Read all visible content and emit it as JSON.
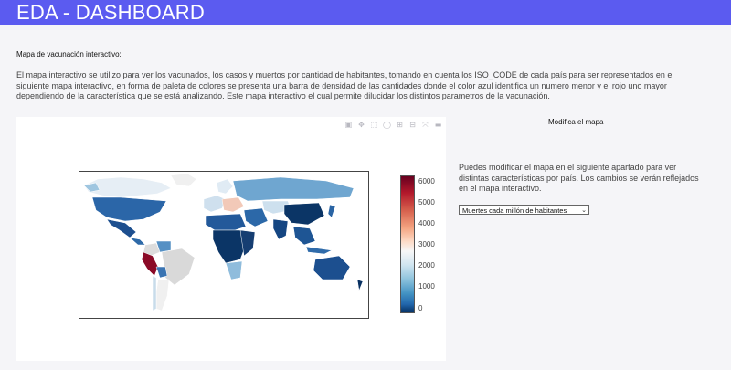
{
  "header": {
    "title": "EDA - DASHBOARD"
  },
  "main": {
    "section_title": "Mapa de vacunación interactivo:",
    "description": "El mapa interactivo se utilizo para ver los vacunados, los casos y muertos por cantidad de habitantes, tomando en cuenta los ISO_CODE de cada país para ser representados en el siguiente mapa interactivo, en forma de paleta de colores se presenta una barra de densidad de las cantidades donde el color azul identifica un numero menor y el rojo uno mayor dependiendo de la característica que se está analizando. Este mapa interactivo el cual permite dilucidar los distintos parametros de la vacunación."
  },
  "map": {
    "toolbar": [
      "camera-icon",
      "pan-icon",
      "box-select-icon",
      "lasso-icon",
      "zoom-in-icon",
      "zoom-out-icon",
      "autoscale-icon",
      "plotly-logo-icon"
    ],
    "colorbar_ticks": [
      "6000",
      "5000",
      "4000",
      "3000",
      "2000",
      "1000",
      "0"
    ],
    "colorscale": "RdBu_r"
  },
  "side": {
    "title": "Modifica el mapa",
    "text": "Puedes modificar el mapa en el siguiente apartado para ver distintas características por país. Los cambios se verán reflejados en el mapa interactivo.",
    "select_value": "Muertes cada millón de habitantes"
  },
  "colors": {
    "header_bg": "#5b5bf0",
    "page_bg": "#f5f5f8"
  }
}
